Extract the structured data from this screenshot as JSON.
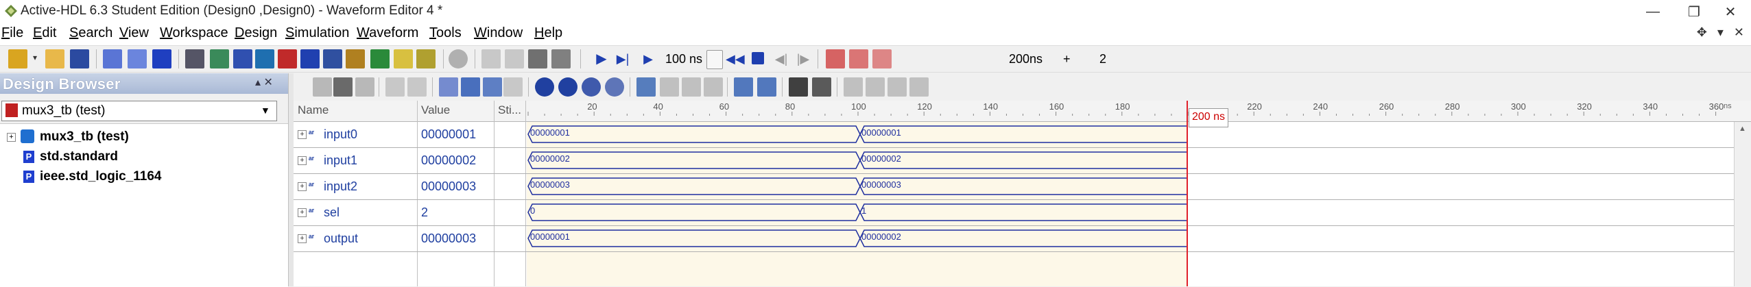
{
  "window": {
    "title": "Active-HDL 6.3 Student Edition (Design0 ,Design0) - Waveform Editor 4 *",
    "minimize": "—",
    "maximize": "❐",
    "close": "✕",
    "mdi_move": "✥",
    "mdi_min": "▾",
    "mdi_close": "✕"
  },
  "menu": {
    "items": [
      {
        "key": "F",
        "rest": "ile"
      },
      {
        "key": "E",
        "rest": "dit"
      },
      {
        "key": "S",
        "rest": "earch"
      },
      {
        "key": "V",
        "rest": "iew"
      },
      {
        "key": "W",
        "rest": "orkspace"
      },
      {
        "key": "D",
        "rest": "esign"
      },
      {
        "key": "S",
        "rest": "imulation"
      },
      {
        "key": "W",
        "rest": "aveform"
      },
      {
        "key": "T",
        "rest": "ools"
      },
      {
        "key": "W",
        "rest": "indow"
      },
      {
        "key": "H",
        "rest": "elp"
      }
    ]
  },
  "toolbar1": {
    "step_time": "100 ns",
    "sim_time": "200ns",
    "plus": "+",
    "count": "2"
  },
  "design_browser": {
    "title": "Design Browser",
    "controls": "▴ ✕",
    "selected_unit": "mux3_tb (test)",
    "tree": [
      {
        "icon": "chip-icon",
        "label": "mux3_tb (test)"
      },
      {
        "icon": "P",
        "label": "std.standard"
      },
      {
        "icon": "P",
        "label": "ieee.std_logic_1164"
      }
    ]
  },
  "waveform": {
    "columns": {
      "name": "Name",
      "value": "Value",
      "stimulator": "Sti..."
    },
    "signals": [
      {
        "name": "input0",
        "value": "00000001",
        "segments": [
          "00000001",
          "00000001"
        ]
      },
      {
        "name": "input1",
        "value": "00000002",
        "segments": [
          "00000002",
          "00000002"
        ]
      },
      {
        "name": "input2",
        "value": "00000003",
        "segments": [
          "00000003",
          "00000003"
        ]
      },
      {
        "name": "sel",
        "value": "2",
        "segments": [
          "0",
          "1"
        ]
      },
      {
        "name": "output",
        "value": "00000003",
        "segments": [
          "00000001",
          "00000002"
        ]
      }
    ],
    "ruler_labels": [
      "20",
      "40",
      "60",
      "80",
      "100",
      "120",
      "140",
      "160",
      "180",
      "220",
      "240",
      "260",
      "280",
      "300",
      "320",
      "340",
      "360"
    ],
    "ruler_unit": "ns",
    "cursor_label": "200 ns"
  },
  "colors": {
    "signal_text": "#1f3fa0",
    "bus_line": "#1f2f9f",
    "canvas_bg": "#fdf8e8",
    "cursor": "#e0202a"
  }
}
